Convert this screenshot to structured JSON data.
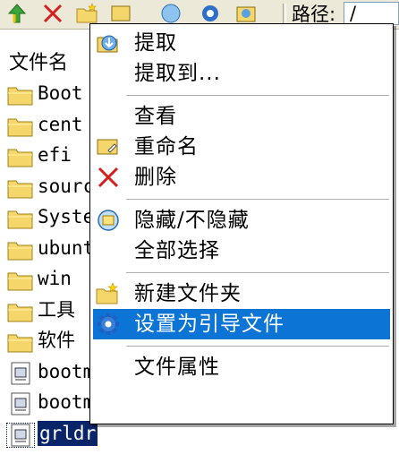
{
  "toolbar": {
    "buttons": [
      {
        "icon": "up-arrow-icon"
      },
      {
        "icon": "delete-x-icon"
      },
      {
        "icon": "new-folder-icon"
      },
      {
        "icon": "rename-icon"
      },
      {
        "icon": "hide-icon"
      },
      {
        "icon": "gear-icon"
      },
      {
        "icon": "extract-icon"
      }
    ],
    "path_label": "路径:",
    "path_value": "/"
  },
  "file_list": {
    "column_header": "文件名",
    "items": [
      {
        "name": "Boot",
        "type": "folder"
      },
      {
        "name": "cent",
        "type": "folder"
      },
      {
        "name": "efi",
        "type": "folder"
      },
      {
        "name": "sourc",
        "type": "folder"
      },
      {
        "name": "Syste",
        "type": "folder"
      },
      {
        "name": "ubunt",
        "type": "folder"
      },
      {
        "name": "win",
        "type": "folder"
      },
      {
        "name": "工具",
        "type": "folder"
      },
      {
        "name": "软件",
        "type": "folder"
      },
      {
        "name": "bootm",
        "type": "file"
      },
      {
        "name": "bootm",
        "type": "file"
      },
      {
        "name": "grldr",
        "type": "file",
        "selected": true
      }
    ]
  },
  "context_menu": {
    "items": [
      {
        "label": "提取",
        "icon": "extract-icon"
      },
      {
        "label": "提取到...",
        "icon": ""
      },
      {
        "separator": true
      },
      {
        "label": "查看",
        "icon": ""
      },
      {
        "label": "重命名",
        "icon": "rename-icon"
      },
      {
        "label": "删除",
        "icon": "delete-x-icon"
      },
      {
        "separator": true
      },
      {
        "label": "隐藏/不隐藏",
        "icon": "hide-icon"
      },
      {
        "label": "全部选择",
        "icon": ""
      },
      {
        "separator": true
      },
      {
        "label": "新建文件夹",
        "icon": "new-folder-icon"
      },
      {
        "label": "设置为引导文件",
        "icon": "gear-icon",
        "highlighted": true
      },
      {
        "separator": true
      },
      {
        "label": "文件属性",
        "icon": ""
      }
    ]
  },
  "colors": {
    "highlight": "#0c74d4",
    "selection": "#0a246a",
    "folder": "#f5d66b",
    "toolbar_bg": "#ece9d8"
  }
}
